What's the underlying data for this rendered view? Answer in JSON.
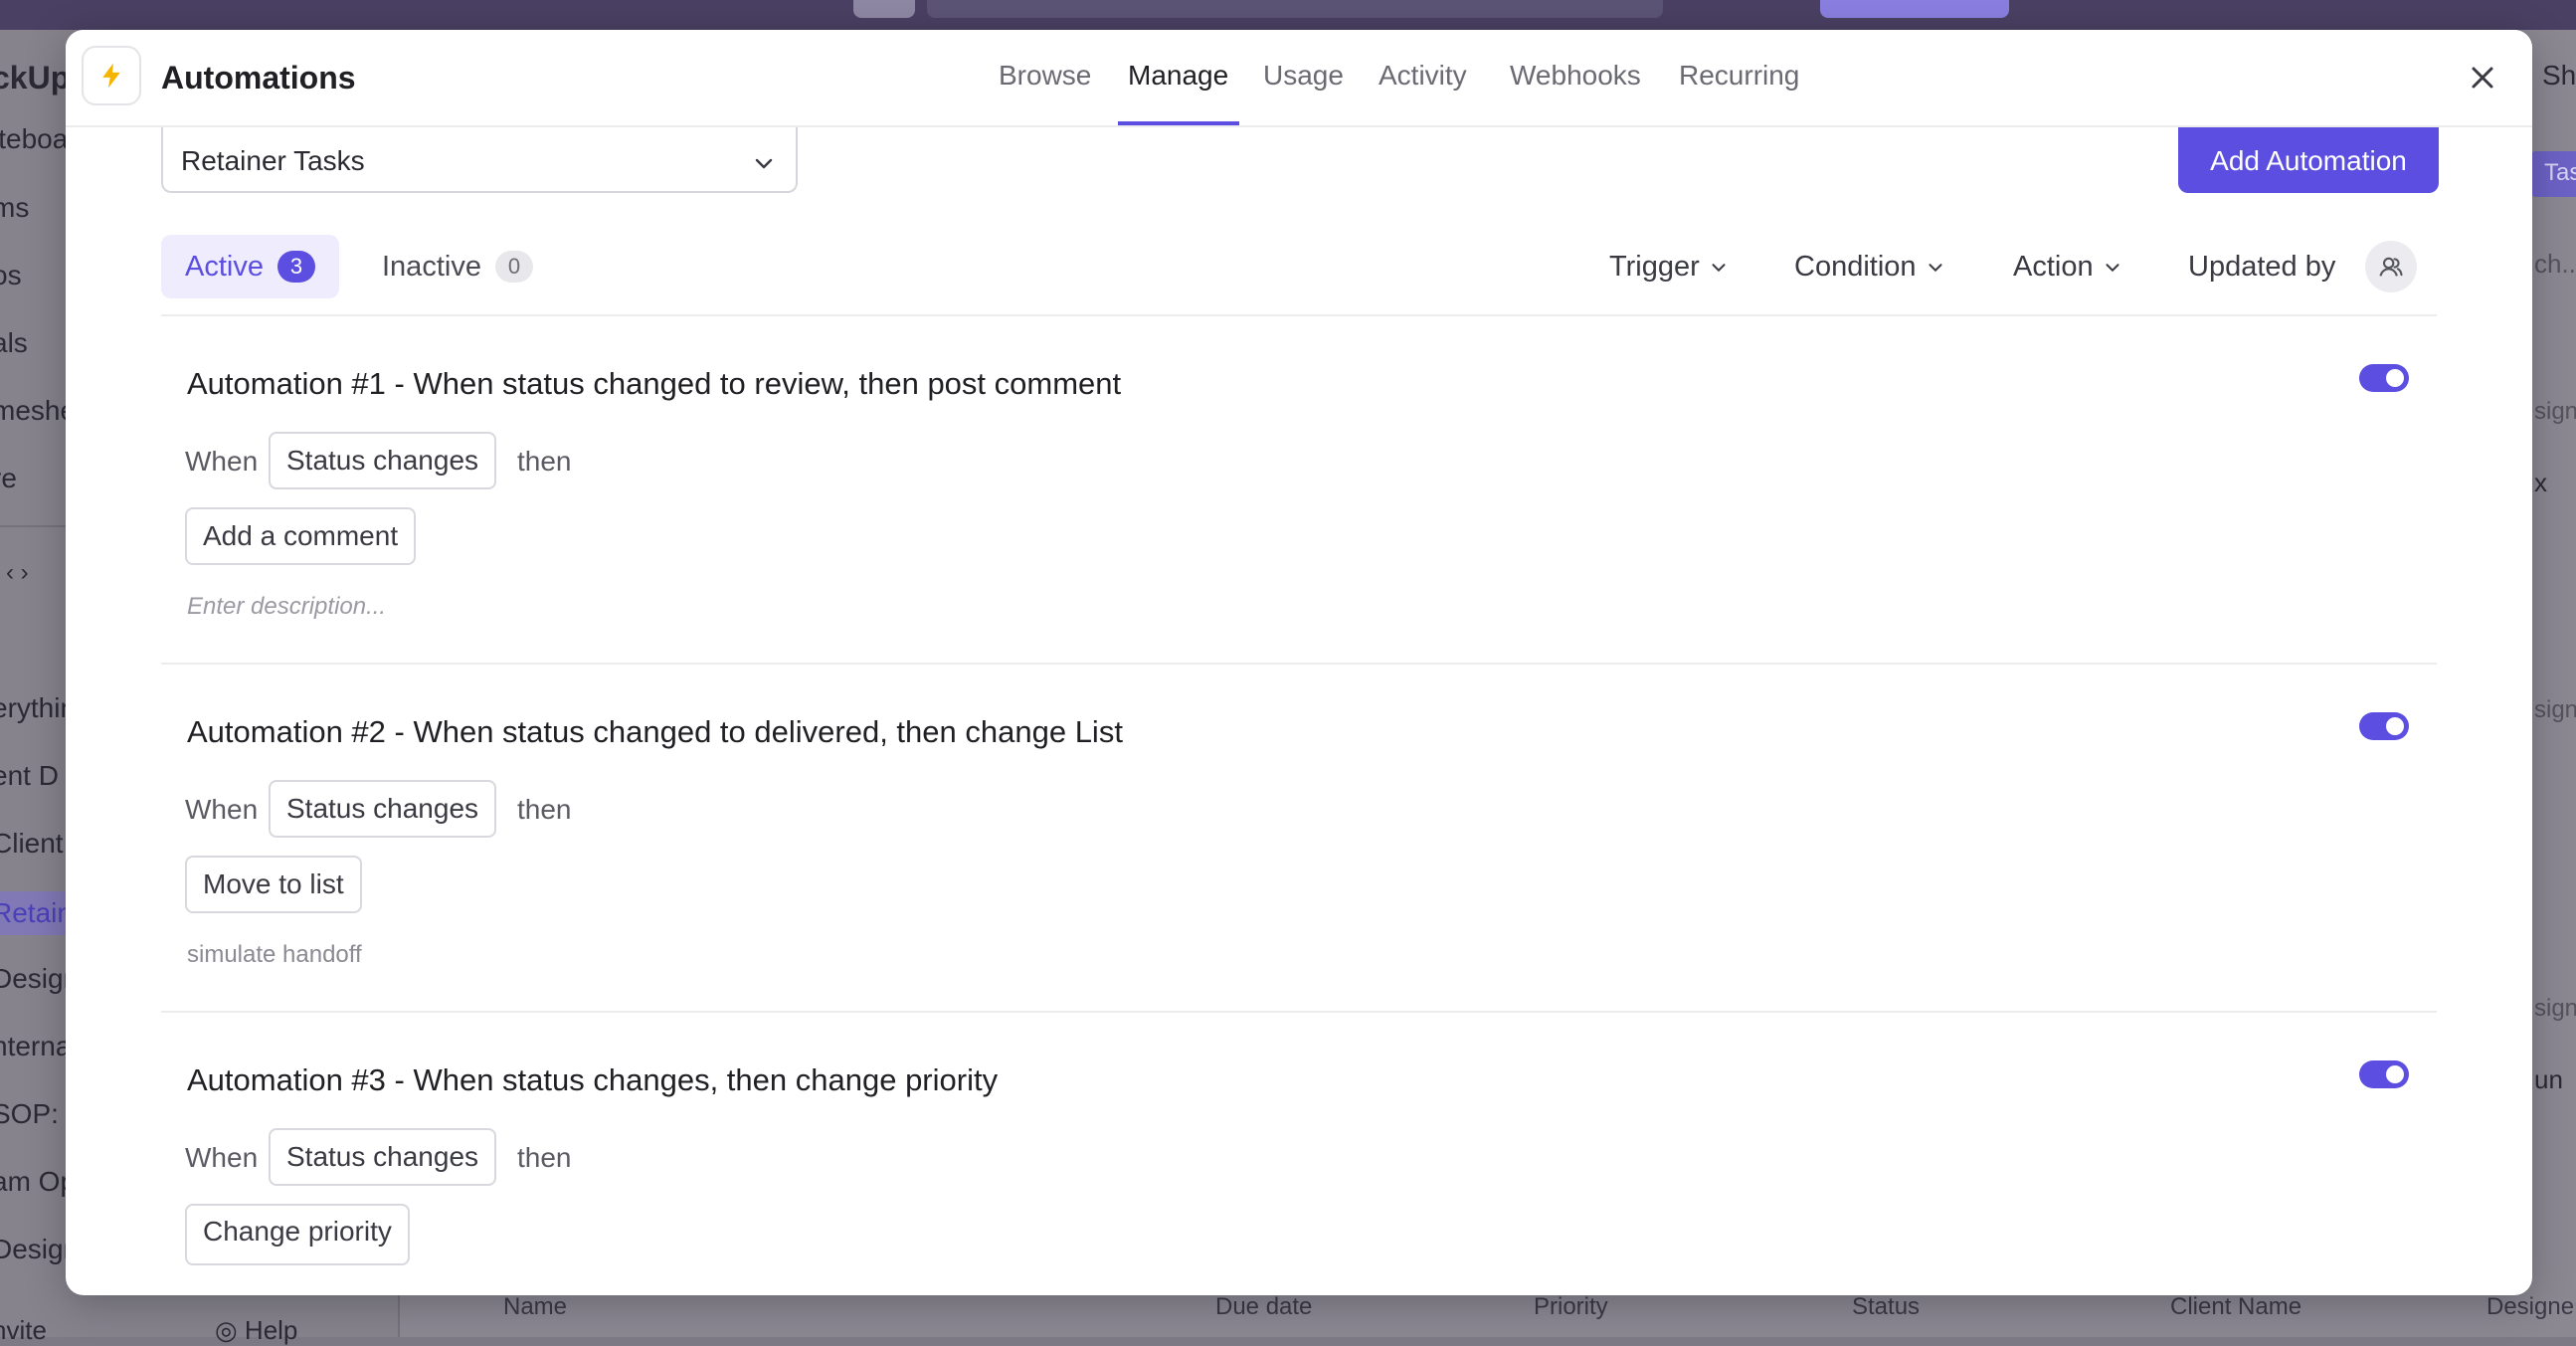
{
  "background": {
    "sidebar_items": [
      "ckUp",
      "iteboa",
      "ms",
      "os",
      "als",
      "meshe",
      "re",
      "erythin",
      "ent D",
      "Client",
      "Retain",
      "Design",
      "nterna",
      "SOP: C",
      "am Op",
      "Design",
      "nvite"
    ],
    "right_button": "Task",
    "right_search": "ch...",
    "right_top": "Sh",
    "right_texts": [
      "signe",
      "x",
      "signe",
      "signe",
      "un"
    ],
    "help": "Help",
    "table_columns": [
      "Name",
      "Due date",
      "Priority",
      "Status",
      "Client Name",
      "Designe"
    ]
  },
  "modal": {
    "title": "Automations",
    "tabs": [
      "Browse",
      "Manage",
      "Usage",
      "Activity",
      "Webhooks",
      "Recurring"
    ],
    "active_tab": "Manage",
    "list_select": "Retainer Tasks",
    "add_button": "Add Automation",
    "filter_tabs": {
      "active": {
        "label": "Active",
        "count": "3"
      },
      "inactive": {
        "label": "Inactive",
        "count": "0"
      }
    },
    "filters": {
      "trigger": "Trigger",
      "condition": "Condition",
      "action": "Action",
      "updated_by": "Updated by"
    },
    "automations": [
      {
        "title": "Automation #1 - When status changed to review, then post comment",
        "when": "When",
        "trigger": "Status changes",
        "then": "then",
        "action": "Add a comment",
        "description": "Enter description...",
        "enabled": true
      },
      {
        "title": "Automation #2 - When status changed to delivered, then change List",
        "when": "When",
        "trigger": "Status changes",
        "then": "then",
        "action": "Move to list",
        "description": "simulate handoff",
        "enabled": true
      },
      {
        "title": "Automation #3 - When status changes, then change priority",
        "when": "When",
        "trigger": "Status changes",
        "then": "then",
        "action": "Change priority",
        "enabled": true
      }
    ]
  },
  "colors": {
    "accent": "#5b4ee0",
    "bolt": "#f5b400"
  }
}
